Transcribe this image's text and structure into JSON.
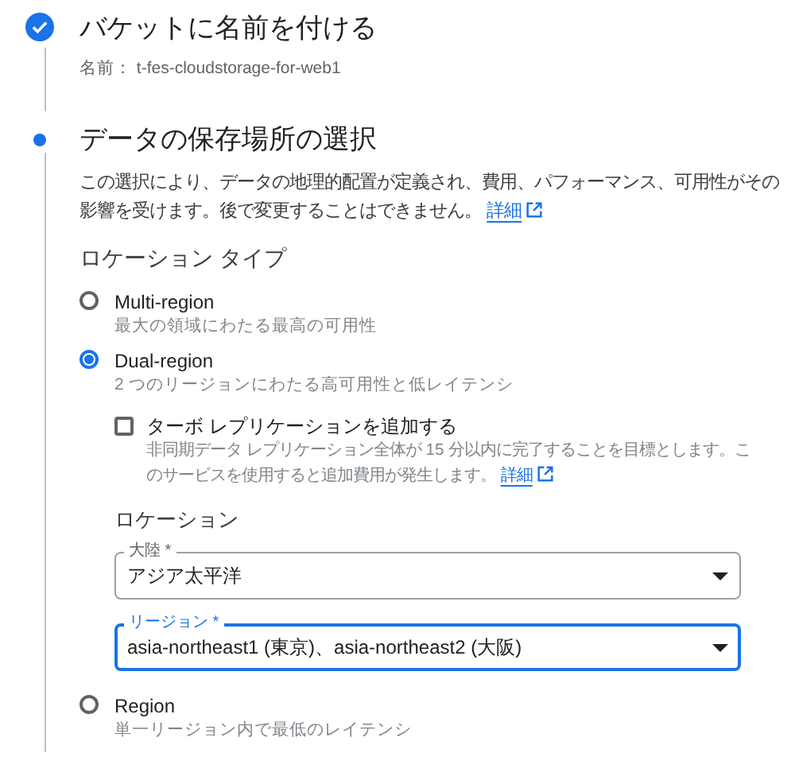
{
  "steps": [
    {
      "title": "バケットに名前を付ける",
      "completed": true,
      "summary": {
        "label": "名前：",
        "value": "t-fes-cloudstorage-for-web1"
      }
    },
    {
      "title": "データの保存場所の選択",
      "completed": false,
      "description": "この選択により、データの地理的配置が定義され、費用、パフォーマンス、可用性がその影響を受けます。後で変更することはできません。",
      "description_link": "詳細",
      "location_type": {
        "heading": "ロケーション タイプ",
        "options": [
          {
            "label": "Multi-region",
            "hint": "最大の領域にわたる最高の可用性",
            "selected": false
          },
          {
            "label": "Dual-region",
            "hint": "2 つのリージョンにわたる高可用性と低レイテンシ",
            "selected": true,
            "turbo": {
              "label": "ターボ レプリケーションを追加する",
              "checked": false,
              "hint": "非同期データ レプリケーション全体が 15 分以内に完了することを目標とします。このサービスを使用すると追加費用が発生します。",
              "link": "詳細"
            },
            "location": {
              "heading": "ロケーション",
              "fields": [
                {
                  "label": "大陸 *",
                  "value": "アジア太平洋",
                  "focused": false
                },
                {
                  "label": "リージョン *",
                  "value": "asia-northeast1 (東京)、asia-northeast2 (大阪)",
                  "focused": true
                }
              ]
            }
          },
          {
            "label": "Region",
            "hint": "単一リージョン内で最低のレイテンシ",
            "selected": false
          }
        ]
      }
    }
  ]
}
